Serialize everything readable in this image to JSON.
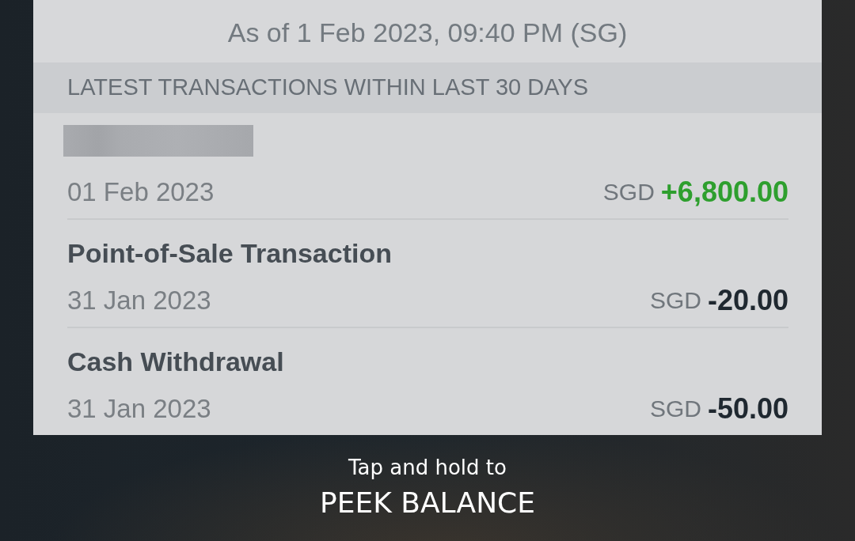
{
  "header": {
    "as_of": "As of 1 Feb 2023, 09:40 PM (SG)"
  },
  "section": {
    "title": "LATEST TRANSACTIONS WITHIN LAST 30 DAYS"
  },
  "transactions": [
    {
      "title_redacted": true,
      "date": "01 Feb 2023",
      "currency": "SGD",
      "amount": "+6,800.00",
      "kind": "credit"
    },
    {
      "title_redacted": false,
      "title": "Point-of-Sale Transaction",
      "date": "31 Jan 2023",
      "currency": "SGD",
      "amount": "-20.00",
      "kind": "debit"
    },
    {
      "title_redacted": false,
      "title": "Cash Withdrawal",
      "date": "31 Jan 2023",
      "currency": "SGD",
      "amount": "-50.00",
      "kind": "debit"
    }
  ],
  "hint": {
    "line_1": "Tap and hold to",
    "line_2": "PEEK BALANCE"
  }
}
